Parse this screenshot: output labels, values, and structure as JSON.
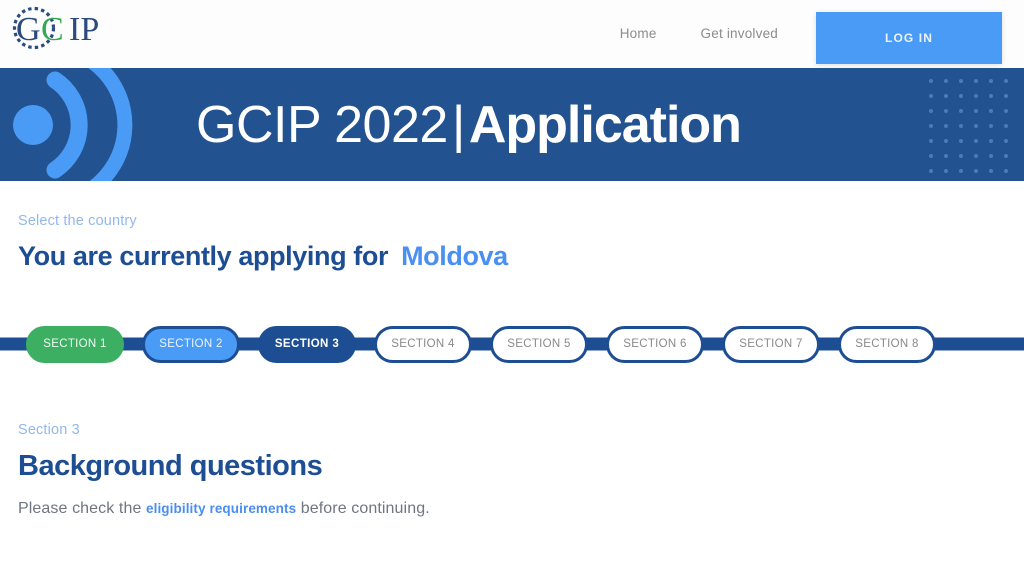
{
  "header": {
    "logo": {
      "text_g": "G",
      "text_c": "C",
      "text_ip": "IP",
      "gear_color": "#2b4a7d",
      "c_color": "#34a853"
    },
    "nav": [
      {
        "label": "Home",
        "name": "nav-home"
      },
      {
        "label": "Get involved",
        "name": "nav-get-involved"
      }
    ],
    "login_label": "LOG IN",
    "login_color": "#4a9bf5"
  },
  "banner": {
    "title_light": "GCIP 2022",
    "title_separator": "|",
    "title_bold": "Application",
    "background": "#22528f",
    "accent": "#4a9bf5"
  },
  "country": {
    "label": "Select the country",
    "prefix": "You are currently applying for",
    "name": "Moldova",
    "name_color": "#4a90f0"
  },
  "stepper": {
    "steps": [
      {
        "label": "SECTION 1",
        "state": "done"
      },
      {
        "label": "SECTION 2",
        "state": "active-prev"
      },
      {
        "label": "SECTION 3",
        "state": "current"
      },
      {
        "label": "SECTION 4",
        "state": "todo"
      },
      {
        "label": "SECTION 5",
        "state": "todo"
      },
      {
        "label": "SECTION 6",
        "state": "todo"
      },
      {
        "label": "SECTION 7",
        "state": "todo"
      },
      {
        "label": "SECTION 8",
        "state": "todo"
      }
    ],
    "done_color": "#3caf63",
    "current_color": "#1d4e93",
    "rail_color": "#1d4e93"
  },
  "section": {
    "eyebrow": "Section 3",
    "title": "Background questions",
    "note_before": "Please check the ",
    "note_link": "eligibility requirements",
    "note_after": " before continuing."
  }
}
